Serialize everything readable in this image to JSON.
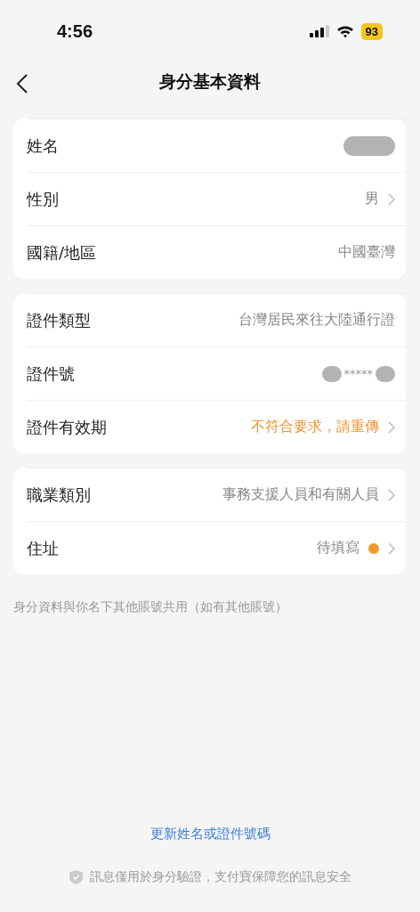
{
  "status_bar": {
    "time": "4:56",
    "battery": "93"
  },
  "nav": {
    "title": "身分基本資料"
  },
  "cards": [
    {
      "rows": [
        {
          "label": "姓名",
          "kind": "redacted",
          "chevron": false
        },
        {
          "label": "性別",
          "kind": "text",
          "value": "男",
          "chevron": true
        },
        {
          "label": "國籍/地區",
          "kind": "text",
          "value": "中國臺灣",
          "chevron": false
        }
      ]
    },
    {
      "rows": [
        {
          "label": "證件類型",
          "kind": "text",
          "value": "台灣居民來往大陸通行證",
          "chevron": false
        },
        {
          "label": "證件號",
          "kind": "masked",
          "value": "*****",
          "chevron": false
        },
        {
          "label": "證件有效期",
          "kind": "warning",
          "value": "不符合要求，請重傳",
          "chevron": true
        }
      ]
    },
    {
      "rows": [
        {
          "label": "職業類別",
          "kind": "text",
          "value": "事務支援人員和有關人員",
          "chevron": true
        },
        {
          "label": "住址",
          "kind": "text",
          "value": "待填寫",
          "chevron": true,
          "color": "#f39a2b"
        }
      ]
    }
  ],
  "note": "身分資料與你名下其他賬號共用（如有其他賬號）",
  "link": "更新姓名或證件號碼",
  "footer": "訊息僅用於身分驗證，支付寶保障您的訊息安全"
}
